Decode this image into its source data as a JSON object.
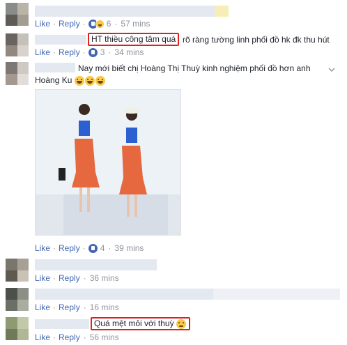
{
  "comments": [
    {
      "actions": {
        "like": "Like",
        "reply": "Reply",
        "reaction_count": "6",
        "time": "57 mins"
      },
      "reactions": [
        "like-icon",
        "haha-icon"
      ]
    },
    {
      "highlighted_text": "HT thiều công tâm quá",
      "text": "rõ ràng tường linh phối đồ hk đk thu hút",
      "actions": {
        "like": "Like",
        "reply": "Reply",
        "reaction_count": "3",
        "time": "34 mins"
      },
      "reactions": [
        "like-icon"
      ]
    },
    {
      "text_line1": "Nay mới biết chị Hoàng Thị Thuỳ kinh nghiệm phối đồ hơn anh",
      "text_line2": "Hoàng Ku",
      "emojis": [
        "laughing-tears-emoji",
        "laughing-tears-emoji",
        "laughing-tears-emoji"
      ],
      "actions": {
        "like": "Like",
        "reply": "Reply",
        "reaction_count": "4",
        "time": "39 mins"
      },
      "reactions": [
        "like-icon"
      ]
    },
    {
      "actions": {
        "like": "Like",
        "reply": "Reply",
        "time": "36 mins"
      }
    },
    {
      "actions": {
        "like": "Like",
        "reply": "Reply",
        "time": "16 mins"
      }
    },
    {
      "highlighted_text": "Quá mệt mỏi với thuỳ",
      "emojis": [
        "crying-face-emoji"
      ],
      "actions": {
        "like": "Like",
        "reply": "Reply",
        "time": "56 mins"
      }
    }
  ],
  "colors": {
    "link": "#4267b2",
    "meta": "#90949c",
    "highlight_border": "#e02020"
  }
}
